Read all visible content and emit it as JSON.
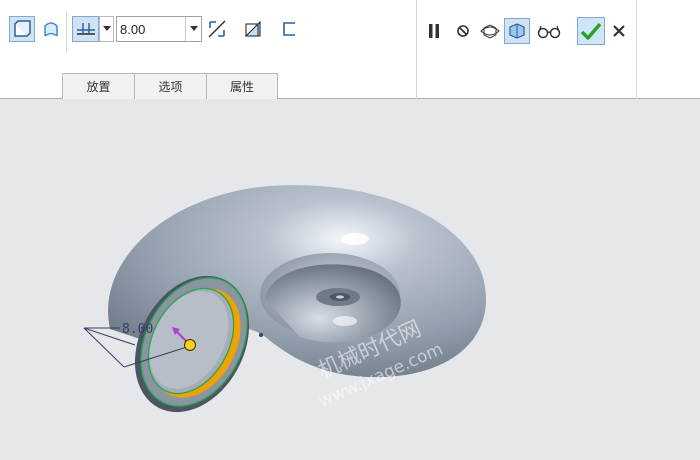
{
  "toolbar": {
    "depth_value": "8.00",
    "tabs": [
      {
        "label": "放置"
      },
      {
        "label": "选项"
      },
      {
        "label": "属性"
      }
    ]
  },
  "viewport": {
    "dimension_value": "8.00",
    "watermark_cn": "机械时代网",
    "watermark_url": "www.jxage.com"
  },
  "icons": {
    "solid": "solid-icon",
    "surface": "surface-icon",
    "thicken": "thicken-icon",
    "flip": "flip-direction-icon",
    "remove_material": "remove-material-icon",
    "thin": "thin-feature-icon",
    "pause": "pause-icon",
    "no_preview": "no-preview-icon",
    "preview": "preview-icon",
    "geometry_preview": "geometry-preview-icon",
    "verify": "verify-glasses-icon",
    "ok": "checkmark-icon",
    "cancel": "close-icon"
  },
  "colors": {
    "ok_green": "#2aa12a",
    "pressed_bg": "#cfe3f5",
    "model_gray": "#97a2b2",
    "highlight_orange": "#f2a200",
    "selection_green": "#26a84a",
    "dimension_magenta": "#b43cd0"
  }
}
